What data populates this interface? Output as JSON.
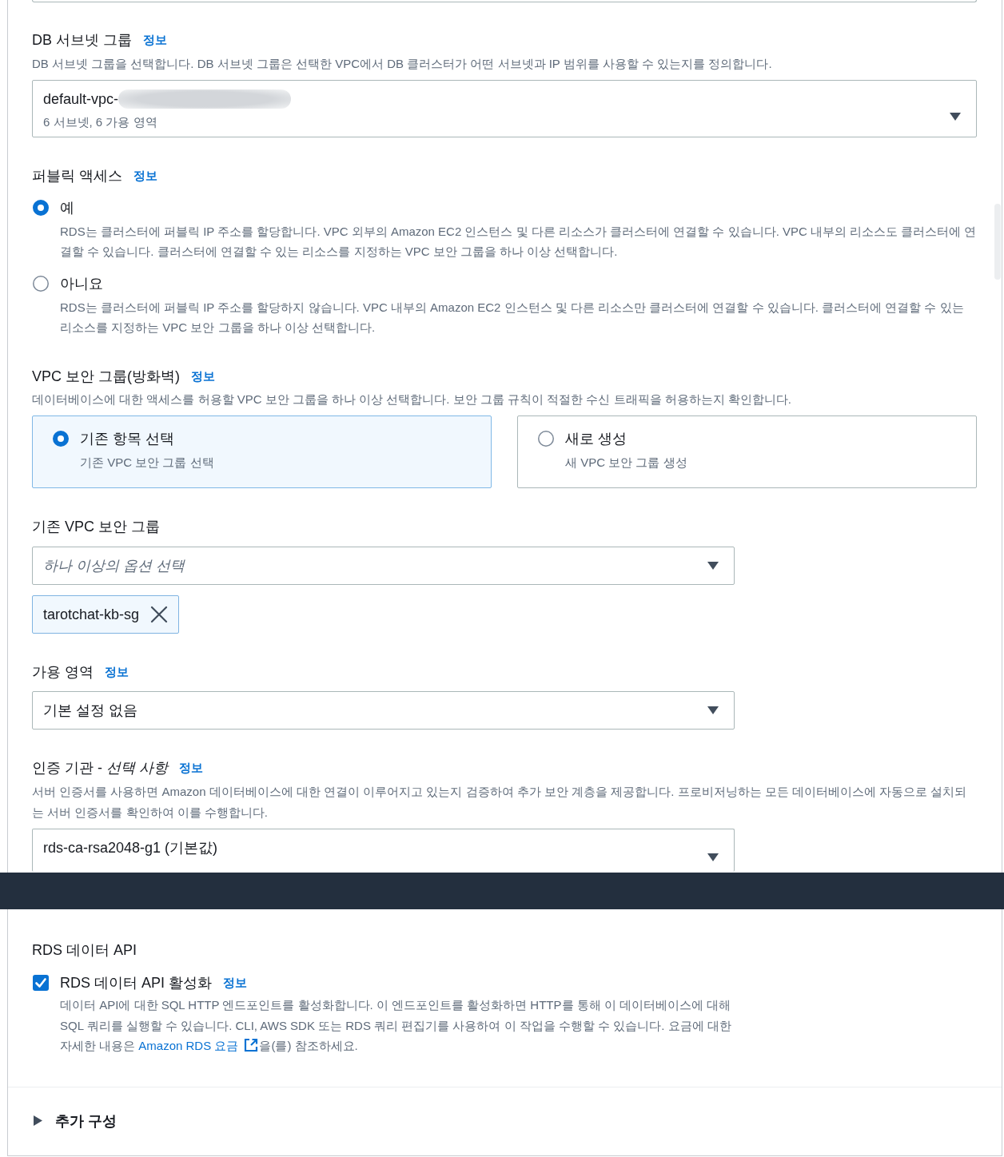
{
  "subnet_group": {
    "label": "DB 서브넷 그룹",
    "info": "정보",
    "description": "DB 서브넷 그룹을 선택합니다. DB 서브넷 그룹은 선택한 VPC에서 DB 클러스터가 어떤 서브넷과 IP 범위를 사용할 수 있는지를 정의합니다.",
    "select": {
      "value": "default-vpc-",
      "redacted": true,
      "detail": "6 서브넷, 6 가용 영역"
    }
  },
  "public_access": {
    "label": "퍼블릭 액세스",
    "info": "정보",
    "options": [
      {
        "label": "예",
        "description": "RDS는 클러스터에 퍼블릭 IP 주소를 할당합니다. VPC 외부의 Amazon EC2 인스턴스 및 다른 리소스가 클러스터에 연결할 수 있습니다. VPC 내부의 리소스도 클러스터에 연결할 수 있습니다. 클러스터에 연결할 수 있는 리소스를 지정하는 VPC 보안 그룹을 하나 이상 선택합니다.",
        "selected": true
      },
      {
        "label": "아니요",
        "description": "RDS는 클러스터에 퍼블릭 IP 주소를 할당하지 않습니다. VPC 내부의 Amazon EC2 인스턴스 및 다른 리소스만 클러스터에 연결할 수 있습니다. 클러스터에 연결할 수 있는 리소스를 지정하는 VPC 보안 그룹을 하나 이상 선택합니다.",
        "selected": false
      }
    ]
  },
  "vpc_security_group": {
    "label": "VPC 보안 그룹(방화벽)",
    "info": "정보",
    "description": "데이터베이스에 대한 액세스를 허용할 VPC 보안 그룹을 하나 이상 선택합니다. 보안 그룹 규칙이 적절한 수신 트래픽을 허용하는지 확인합니다.",
    "tiles": [
      {
        "title": "기존 항목 선택",
        "description": "기존 VPC 보안 그룹 선택",
        "selected": true
      },
      {
        "title": "새로 생성",
        "description": "새 VPC 보안 그룹 생성",
        "selected": false
      }
    ]
  },
  "existing_security_groups": {
    "label": "기존 VPC 보안 그룹",
    "placeholder": "하나 이상의 옵션 선택",
    "tokens": [
      {
        "label": "tarotchat-kb-sg"
      }
    ]
  },
  "availability_zone": {
    "label": "가용 영역",
    "info": "정보",
    "select": {
      "value": "기본 설정 없음"
    }
  },
  "certificate_authority": {
    "label": "인증 기관 - *선택 사항*",
    "info": "정보",
    "description": "서버 인증서를 사용하면 Amazon 데이터베이스에 대한 연결이 이루어지고 있는지 검증하여 추가 보안 계층을 제공합니다. 프로비저닝하는 모든 데이터베이스에 자동으로 설치되는 서버 인증서를 확인하여 이를 수행합니다.",
    "select": {
      "value": "rds-ca-rsa2048-g1 (기본값)"
    }
  },
  "data_api": {
    "label": "RDS 데이터 API",
    "checkbox": {
      "label": "RDS 데이터 API 활성화",
      "info": "정보",
      "checked": true,
      "description_before": "데이터 API에 대한 SQL HTTP 엔드포인트를 활성화합니다. 이 엔드포인트를 활성화하면 HTTP를 통해 이 데이터베이스에 대해 SQL 쿼리를 실행할 수 있습니다. CLI, AWS SDK 또는 RDS 쿼리 편집기를 사용하여 이 작업을 수행할 수 있습니다. 요금에 대한 자세한 내용은 ",
      "link": "Amazon RDS 요금",
      "description_after": "을(를) 참조하세요."
    }
  },
  "additional_config": {
    "label": "추가 구성",
    "expanded": false
  }
}
